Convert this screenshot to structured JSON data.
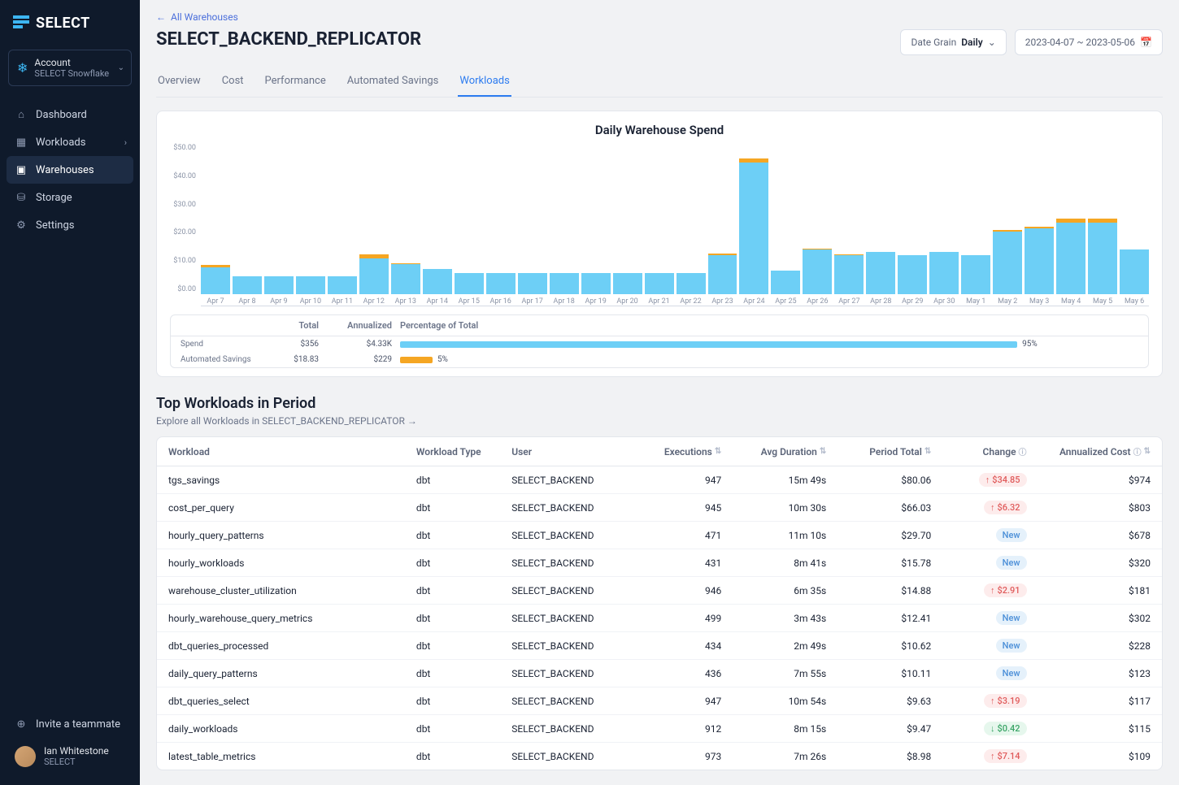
{
  "logo": "SELECT",
  "account": {
    "label": "Account",
    "name": "SELECT Snowflake"
  },
  "nav": {
    "dashboard": "Dashboard",
    "workloads": "Workloads",
    "warehouses": "Warehouses",
    "storage": "Storage",
    "settings": "Settings"
  },
  "invite": "Invite a teammate",
  "user": {
    "name": "Ian Whitestone",
    "org": "SELECT"
  },
  "breadcrumb": "All Warehouses",
  "title": "SELECT_BACKEND_REPLICATOR",
  "date_grain": {
    "label": "Date Grain",
    "value": "Daily"
  },
  "date_range": "2023-04-07 ~ 2023-05-06",
  "tabs": {
    "overview": "Overview",
    "cost": "Cost",
    "performance": "Performance",
    "automated_savings": "Automated Savings",
    "workloads": "Workloads"
  },
  "chart_data": {
    "type": "bar",
    "title": "Daily Warehouse Spend",
    "ylabel": "",
    "xlabel": "",
    "ylim": [
      0,
      50
    ],
    "y_ticks": [
      "$50.00",
      "$40.00",
      "$30.00",
      "$20.00",
      "$10.00",
      "$0.00"
    ],
    "categories": [
      "Apr 7",
      "Apr 8",
      "Apr 9",
      "Apr 10",
      "Apr 11",
      "Apr 12",
      "Apr 13",
      "Apr 14",
      "Apr 15",
      "Apr 16",
      "Apr 17",
      "Apr 18",
      "Apr 19",
      "Apr 20",
      "Apr 21",
      "Apr 22",
      "Apr 23",
      "Apr 24",
      "Apr 25",
      "Apr 26",
      "Apr 27",
      "Apr 28",
      "Apr 29",
      "Apr 30",
      "May 1",
      "May 2",
      "May 3",
      "May 4",
      "May 5",
      "May 6"
    ],
    "series": [
      {
        "name": "Spend",
        "color": "#6DCFF6",
        "values": [
          9,
          6,
          6,
          6,
          6,
          12,
          10,
          8.5,
          7,
          7,
          7,
          7,
          7,
          7,
          7,
          7,
          13,
          44,
          8,
          15,
          13,
          14,
          13,
          14,
          13,
          21,
          22,
          24,
          24,
          15
        ]
      },
      {
        "name": "Automated Savings",
        "color": "#F5A623",
        "values": [
          0.7,
          0,
          0,
          0,
          0,
          1.2,
          0.3,
          0,
          0,
          0,
          0,
          0,
          0,
          0,
          0,
          0,
          0.7,
          1.5,
          0,
          0.3,
          0.3,
          0,
          0,
          0,
          0,
          0.5,
          0.5,
          1.2,
          1.2,
          0
        ]
      }
    ]
  },
  "summary": {
    "headers": {
      "total": "Total",
      "annualized": "Annualized",
      "pct": "Percentage of Total"
    },
    "rows": [
      {
        "label": "Spend",
        "total": "$356",
        "annualized": "$4.33K",
        "pct": 95,
        "color": "blue"
      },
      {
        "label": "Automated Savings",
        "total": "$18.83",
        "annualized": "$229",
        "pct": 5,
        "color": "orange"
      }
    ]
  },
  "workloads_section": {
    "title": "Top Workloads in Period",
    "link": "Explore all Workloads in SELECT_BACKEND_REPLICATOR →"
  },
  "table": {
    "headers": {
      "workload": "Workload",
      "type": "Workload Type",
      "user": "User",
      "executions": "Executions",
      "avg_duration": "Avg Duration",
      "period_total": "Period Total",
      "change": "Change",
      "annualized": "Annualized Cost"
    },
    "rows": [
      {
        "workload": "tgs_savings",
        "type": "dbt",
        "user": "SELECT_BACKEND",
        "executions": "947",
        "avg_duration": "15m 49s",
        "period_total": "$80.06",
        "change": {
          "kind": "up",
          "text": "$34.85"
        },
        "annualized": "$974"
      },
      {
        "workload": "cost_per_query",
        "type": "dbt",
        "user": "SELECT_BACKEND",
        "executions": "945",
        "avg_duration": "10m 30s",
        "period_total": "$66.03",
        "change": {
          "kind": "up",
          "text": "$6.32"
        },
        "annualized": "$803"
      },
      {
        "workload": "hourly_query_patterns",
        "type": "dbt",
        "user": "SELECT_BACKEND",
        "executions": "471",
        "avg_duration": "11m 10s",
        "period_total": "$29.70",
        "change": {
          "kind": "new",
          "text": "New"
        },
        "annualized": "$678"
      },
      {
        "workload": "hourly_workloads",
        "type": "dbt",
        "user": "SELECT_BACKEND",
        "executions": "431",
        "avg_duration": "8m 41s",
        "period_total": "$15.78",
        "change": {
          "kind": "new",
          "text": "New"
        },
        "annualized": "$320"
      },
      {
        "workload": "warehouse_cluster_utilization",
        "type": "dbt",
        "user": "SELECT_BACKEND",
        "executions": "946",
        "avg_duration": "6m 35s",
        "period_total": "$14.88",
        "change": {
          "kind": "up",
          "text": "$2.91"
        },
        "annualized": "$181"
      },
      {
        "workload": "hourly_warehouse_query_metrics",
        "type": "dbt",
        "user": "SELECT_BACKEND",
        "executions": "499",
        "avg_duration": "3m 43s",
        "period_total": "$12.41",
        "change": {
          "kind": "new",
          "text": "New"
        },
        "annualized": "$302"
      },
      {
        "workload": "dbt_queries_processed",
        "type": "dbt",
        "user": "SELECT_BACKEND",
        "executions": "434",
        "avg_duration": "2m 49s",
        "period_total": "$10.62",
        "change": {
          "kind": "new",
          "text": "New"
        },
        "annualized": "$228"
      },
      {
        "workload": "daily_query_patterns",
        "type": "dbt",
        "user": "SELECT_BACKEND",
        "executions": "436",
        "avg_duration": "7m 55s",
        "period_total": "$10.11",
        "change": {
          "kind": "new",
          "text": "New"
        },
        "annualized": "$123"
      },
      {
        "workload": "dbt_queries_select",
        "type": "dbt",
        "user": "SELECT_BACKEND",
        "executions": "947",
        "avg_duration": "10m 54s",
        "period_total": "$9.63",
        "change": {
          "kind": "up",
          "text": "$3.19"
        },
        "annualized": "$117"
      },
      {
        "workload": "daily_workloads",
        "type": "dbt",
        "user": "SELECT_BACKEND",
        "executions": "912",
        "avg_duration": "8m 15s",
        "period_total": "$9.47",
        "change": {
          "kind": "down",
          "text": "$0.42"
        },
        "annualized": "$115"
      },
      {
        "workload": "latest_table_metrics",
        "type": "dbt",
        "user": "SELECT_BACKEND",
        "executions": "973",
        "avg_duration": "7m 26s",
        "period_total": "$8.98",
        "change": {
          "kind": "up",
          "text": "$7.14"
        },
        "annualized": "$109"
      }
    ]
  }
}
